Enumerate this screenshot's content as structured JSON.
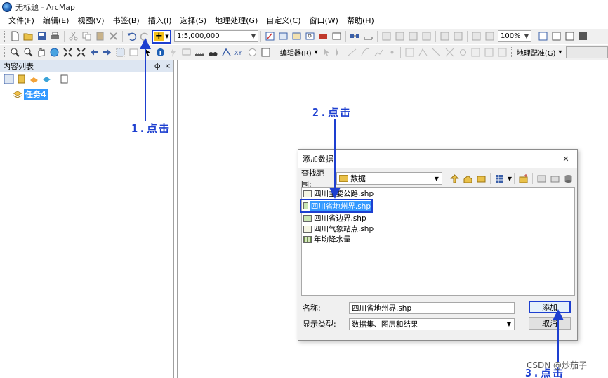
{
  "window": {
    "title": "无标题 - ArcMap"
  },
  "menubar": {
    "items": [
      "文件(F)",
      "编辑(E)",
      "视图(V)",
      "书签(B)",
      "插入(I)",
      "选择(S)",
      "地理处理(G)",
      "自定义(C)",
      "窗口(W)",
      "帮助(H)"
    ]
  },
  "toolbar1": {
    "scale": "1:5,000,000",
    "zoom": "100%"
  },
  "toolbar2": {
    "editor_label": "编辑器(R)",
    "georef_label": "地理配准(G)"
  },
  "toc": {
    "title": "内容列表",
    "pin": "ф",
    "close": "×",
    "layer_name": "任务4"
  },
  "dialog": {
    "title": "添加数据",
    "close": "✕",
    "lookin_label": "查找范围:",
    "lookin_value": "数据",
    "files": [
      {
        "name": "四川主要公路.shp",
        "kind": "line"
      },
      {
        "name": "四川省地州界.shp",
        "kind": "polygon",
        "selected": true
      },
      {
        "name": "四川省边界.shp",
        "kind": "polygon"
      },
      {
        "name": "四川气象站点.shp",
        "kind": "point"
      },
      {
        "name": "年均降水量",
        "kind": "raster"
      }
    ],
    "name_label": "名称:",
    "name_value": "四川省地州界.shp",
    "type_label": "显示类型:",
    "type_value": "数据集、图层和结果",
    "add_button": "添加",
    "cancel_button": "取消"
  },
  "annotations": {
    "step1": "1.点击",
    "step2": "2.点击",
    "step3": "3.点击",
    "color": "#1d3fd0"
  },
  "watermark": "CSDN @炒茄子"
}
